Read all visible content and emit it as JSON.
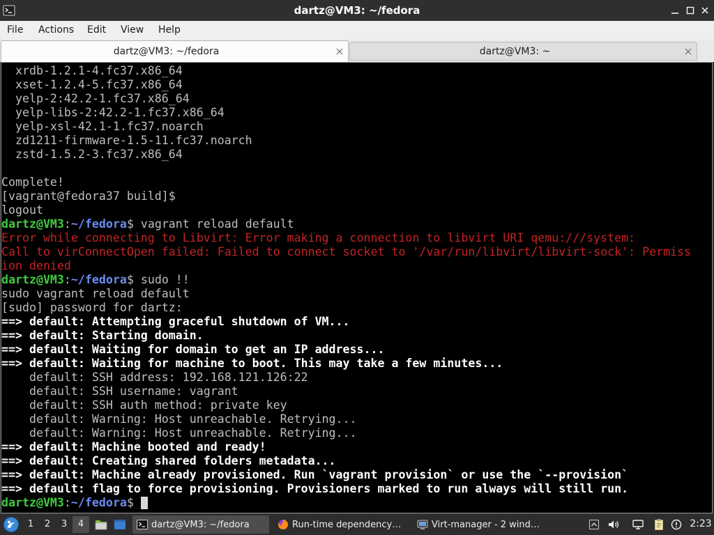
{
  "window": {
    "title": "dartz@VM3: ~/fedora",
    "app_icon": "terminal-icon",
    "controls": [
      "minimize-icon",
      "maximize-icon",
      "close-icon"
    ]
  },
  "menu": [
    "File",
    "Actions",
    "Edit",
    "View",
    "Help"
  ],
  "tabs": [
    {
      "label": "dartz@VM3: ~/fedora",
      "active": true,
      "close_icon": "tab-close-icon"
    },
    {
      "label": "dartz@VM3: ~",
      "active": false,
      "close_icon": "tab-close-icon"
    }
  ],
  "terminal": {
    "prompt": {
      "user_host": "dartz@VM3",
      "separator": ":",
      "cwd": "~/fedora",
      "symbol": "$"
    },
    "lines": [
      "  xrdb-1.2.1-4.fc37.x86_64",
      "  xset-1.2.4-5.fc37.x86_64",
      "  yelp-2:42.2-1.fc37.x86_64",
      "  yelp-libs-2:42.2-1.fc37.x86_64",
      "  yelp-xsl-42.1-1.fc37.noarch",
      "  zd1211-firmware-1.5-11.fc37.noarch",
      "  zstd-1.5.2-3.fc37.x86_64",
      "",
      "Complete!",
      "[vagrant@fedora37 build]$",
      "logout",
      "vagrant reload default",
      "Error while connecting to Libvirt: Error making a connection to libvirt URI qemu:///system:",
      "Call to virConnectOpen failed: Failed to connect socket to '/var/run/libvirt/libvirt-sock': Permiss",
      "ion denied",
      "sudo !!",
      "sudo vagrant reload default",
      "[sudo] password for dartz:",
      "==> default: Attempting graceful shutdown of VM...",
      "==> default: Starting domain.",
      "==> default: Waiting for domain to get an IP address...",
      "==> default: Waiting for machine to boot. This may take a few minutes...",
      "    default: SSH address: 192.168.121.126:22",
      "    default: SSH username: vagrant",
      "    default: SSH auth method: private key",
      "    default: Warning: Host unreachable. Retrying...",
      "    default: Warning: Host unreachable. Retrying...",
      "==> default: Machine booted and ready!",
      "==> default: Creating shared folders metadata...",
      "==> default: Machine already provisioned. Run `vagrant provision` or use the `--provision`",
      "==> default: flag to force provisioning. Provisioners marked to run always will still run.",
      ""
    ]
  },
  "taskbar": {
    "start_icon": "start-menu-icon",
    "desktops": {
      "items": [
        "1",
        "2",
        "3",
        "4"
      ],
      "active": 4
    },
    "launchers": [
      "file-manager-icon",
      "show-desktop-icon"
    ],
    "tasks": [
      {
        "label": "dartz@VM3: ~/fedora",
        "icon": "terminal-icon",
        "active": true
      },
      {
        "label": "Run-time dependency…",
        "icon": "firefox-icon",
        "active": false
      },
      {
        "label": "Virt-manager - 2 wind…",
        "icon": "virt-manager-icon",
        "active": false
      }
    ],
    "tray": [
      "show-hidden-icons-icon",
      "volume-icon",
      "network-icon",
      "clipboard-icon",
      "update-notifier-icon"
    ],
    "clock": "2:23"
  },
  "colors": {
    "terminal_bg": "#000000",
    "terminal_fg": "#bfbfbf",
    "terminal_bold_fg": "#ffffff",
    "prompt_user_host": "#3fcc3f",
    "prompt_cwd": "#6b8cf2",
    "error_text": "#c42323",
    "cursor": "#d8d8d8",
    "titlebar_bg": "#2f2f2f",
    "menubar_bg": "#efefef",
    "taskbar_bg": "#2d2d2d",
    "taskbar_active": "#4d4d4d"
  }
}
